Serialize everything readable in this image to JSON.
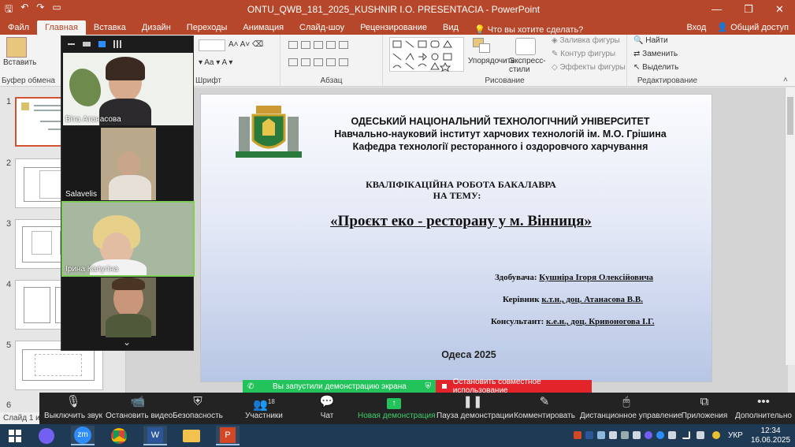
{
  "titlebar": {
    "title": "ONTU_QWB_181_2025_KUSHNIR I.O. PRESENTACIA - PowerPoint",
    "min": "—",
    "max": "❐",
    "close": "✕"
  },
  "tabs": [
    "Файл",
    "Главная",
    "Вставка",
    "Дизайн",
    "Переходы",
    "Анимация",
    "Слайд-шоу",
    "Рецензирование",
    "Вид"
  ],
  "tell_me": "Что вы хотите сделать?",
  "account": {
    "signin": "Вход",
    "share": "Общий доступ"
  },
  "ribbon": {
    "paste": "Вставить",
    "groups": {
      "clipboard": "Буфер обмена",
      "font": "Шрифт",
      "paragraph": "Абзац",
      "drawing": "Рисование",
      "editing": "Редактирование"
    },
    "drawing": {
      "arrange": "Упорядочить",
      "quick_styles": "Экспресс-стили",
      "fill": "Заливка фигуры",
      "outline": "Контур фигуры",
      "effects": "Эффекты фигуры"
    },
    "editing": {
      "find": "Найти",
      "replace": "Заменить",
      "select": "Выделить"
    }
  },
  "slides_panel": {
    "numbers": [
      "1",
      "2",
      "3",
      "4",
      "5",
      "6"
    ]
  },
  "slide": {
    "uni1": "ОДЕСЬКИЙ НАЦІОНАЛЬНИЙ ТЕХНОЛОГІЧНИЙ УНІВЕРСИТЕТ",
    "uni2": "Навчально-науковий інститут харчових технологій ім. М.О. Грішина",
    "uni3": "Кафедра технології ресторанного і оздоровчого харчування",
    "work1": "КВАЛІФІКАЦІЙНА РОБОТА БАКАЛАВРА",
    "work2": "НА ТЕМУ:",
    "topic": "«Проєкт еко - ресторану у  м. Вінниця»",
    "applicant_label": "Здобувача:",
    "applicant": "Кушніра Ігоря Олексійовича",
    "supervisor_label": "Керівник",
    "supervisor": "к.т.н., доц. Атанасова В.В.",
    "consultant_label": "Консультант:",
    "consultant": "к.е.н., доц. Кривоногова І.Г.",
    "city": "Одеса 2025"
  },
  "zoom_gallery": {
    "participants": [
      {
        "name": "Віта Атанасова"
      },
      {
        "name": "Salavelis"
      },
      {
        "name": "Ірина Калугіна"
      },
      {
        "name": ""
      }
    ],
    "more": "⌄"
  },
  "share_banner": {
    "started": "Вы запустили демонстрацию экрана",
    "stop": "Остановить совместное использование"
  },
  "zoom_toolbar": {
    "mute": "Выключить звук",
    "video": "Остановить видео",
    "security": "Безопасность",
    "participants": "Участники",
    "participants_count": "18",
    "chat": "Чат",
    "new_share": "Новая демонстрация",
    "pause": "Пауза демонстрации",
    "annotate": "Комментировать",
    "remote": "Дистанционное управление",
    "apps": "Приложения",
    "more": "Дополнительно"
  },
  "status": {
    "slide": "Слайд 1 из 24"
  },
  "taskbar": {
    "lang": "УКР",
    "time": "12:34",
    "date": "16.06.2025",
    "zoom_label": "zm"
  }
}
